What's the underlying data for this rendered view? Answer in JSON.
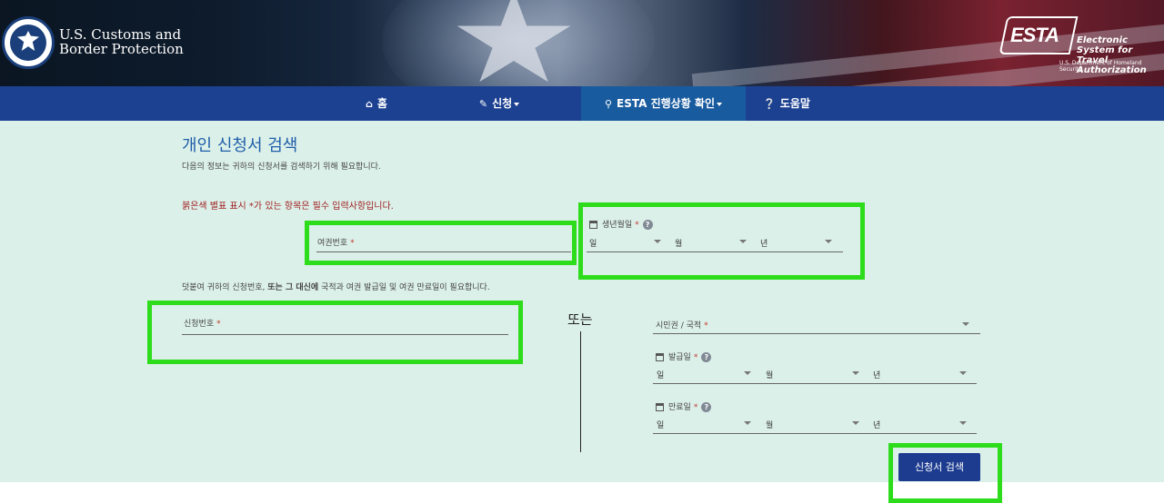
{
  "header": {
    "agency_line1": "U.S. Customs and",
    "agency_line2": "Border Protection",
    "esta_word": "ESTA",
    "esta_tag_line1": "Electronic System for",
    "esta_tag_line2": "Travel Authorization",
    "esta_dept": "U.S. Department of Homeland Security"
  },
  "nav": {
    "items": [
      {
        "label": "홈",
        "icon": "home-icon"
      },
      {
        "label": "신청",
        "icon": "pencil-icon",
        "has_dropdown": true
      },
      {
        "label": "ESTA 진행상황 확인",
        "icon": "search-icon",
        "has_dropdown": true,
        "active": true
      },
      {
        "label": "도움말",
        "icon": "question-circle-icon"
      }
    ]
  },
  "form": {
    "title": "개인 신청서 검색",
    "subtitle": "다음의 정보는 귀하의 신청서를 검색하기 위해 필요합니다.",
    "required_note": "붉은색 별표 표시 *가 있는 항목은 필수 입력사항입니다.",
    "passport_label": "여권번호",
    "birth_label": "생년월일",
    "day_placeholder": "일",
    "month_placeholder": "월",
    "year_placeholder": "년",
    "additional_note_prefix": "덧붙여 귀하의 신청번호, ",
    "additional_note_bold": "또는 그 대신에",
    "additional_note_suffix": " 국적과 여권 발급일 및 여권 만료일이 필요합니다.",
    "application_number_label": "신청번호",
    "or_text": "또는",
    "citizenship_label": "시민권 / 국적",
    "issue_date_label": "발급일",
    "expiry_date_label": "만료일",
    "required_mark": "*",
    "help_mark": "?",
    "search_button": "신청서 검색"
  },
  "colors": {
    "nav_bg": "#1d4191",
    "nav_active": "#195b9f",
    "main_bg": "#dcf0ea",
    "title": "#1e5ea8",
    "required": "#9e1b1b",
    "button_bg": "#1d3c8f",
    "highlight": "#2ddc1a"
  }
}
